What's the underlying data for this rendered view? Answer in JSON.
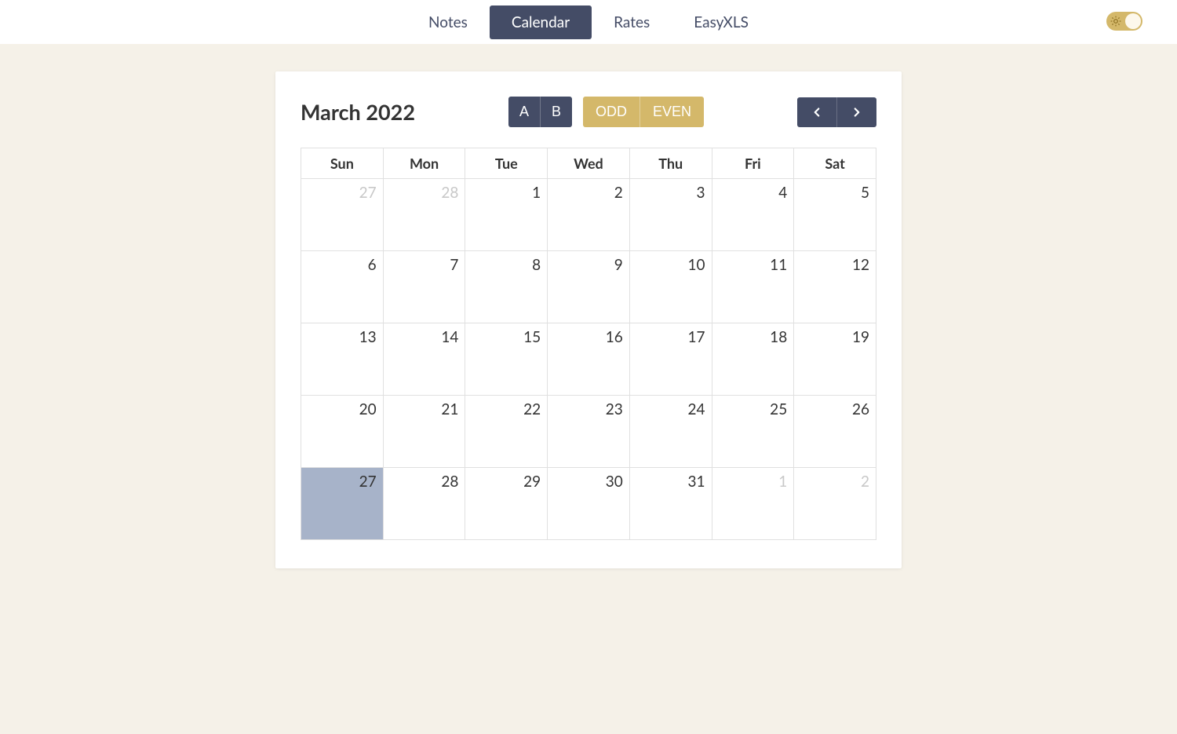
{
  "nav": {
    "tabs": [
      "Notes",
      "Calendar",
      "Rates",
      "EasyXLS"
    ],
    "active_index": 1
  },
  "theme_toggle": {
    "mode": "light"
  },
  "calendar": {
    "title": "March 2022",
    "filters_ab": [
      "A",
      "B"
    ],
    "filters_parity": [
      "ODD",
      "EVEN"
    ],
    "day_headers": [
      "Sun",
      "Mon",
      "Tue",
      "Wed",
      "Thu",
      "Fri",
      "Sat"
    ],
    "weeks": [
      [
        {
          "n": "27",
          "other": true
        },
        {
          "n": "28",
          "other": true
        },
        {
          "n": "1"
        },
        {
          "n": "2"
        },
        {
          "n": "3"
        },
        {
          "n": "4"
        },
        {
          "n": "5"
        }
      ],
      [
        {
          "n": "6"
        },
        {
          "n": "7"
        },
        {
          "n": "8"
        },
        {
          "n": "9"
        },
        {
          "n": "10"
        },
        {
          "n": "11"
        },
        {
          "n": "12"
        }
      ],
      [
        {
          "n": "13"
        },
        {
          "n": "14"
        },
        {
          "n": "15"
        },
        {
          "n": "16"
        },
        {
          "n": "17"
        },
        {
          "n": "18"
        },
        {
          "n": "19"
        }
      ],
      [
        {
          "n": "20"
        },
        {
          "n": "21"
        },
        {
          "n": "22"
        },
        {
          "n": "23"
        },
        {
          "n": "24"
        },
        {
          "n": "25"
        },
        {
          "n": "26"
        }
      ],
      [
        {
          "n": "27",
          "today": true
        },
        {
          "n": "28"
        },
        {
          "n": "29"
        },
        {
          "n": "30"
        },
        {
          "n": "31"
        },
        {
          "n": "1",
          "other": true
        },
        {
          "n": "2",
          "other": true
        }
      ]
    ]
  }
}
